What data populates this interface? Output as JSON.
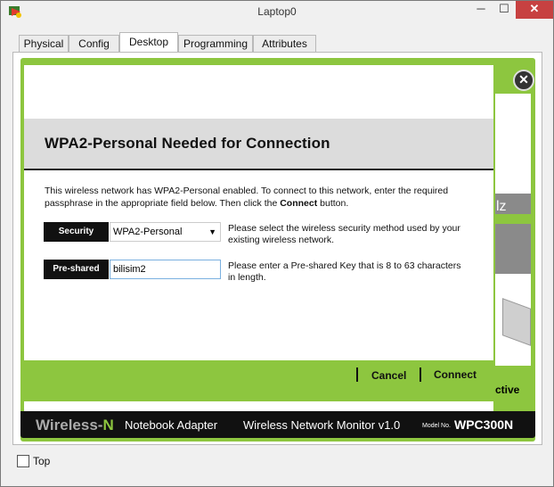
{
  "window": {
    "title": "Laptop0",
    "minimize": "─",
    "maximize": "☐",
    "close": "✕"
  },
  "tabs": [
    {
      "label": "Physical"
    },
    {
      "label": "Config"
    },
    {
      "label": "Desktop"
    },
    {
      "label": "Programming"
    },
    {
      "label": "Attributes"
    }
  ],
  "active_tab": "Desktop",
  "background_app": {
    "partial_text": "lz",
    "status_text": "ctive"
  },
  "dialog": {
    "heading": "WPA2-Personal Needed for Connection",
    "intro_pre": "This wireless network has WPA2-Personal enabled. To connect to this network, enter the required passphrase in the appropriate field below. Then click the ",
    "intro_bold": "Connect",
    "intro_post": " button.",
    "security_label": "Security",
    "security_value": "WPA2-Personal",
    "security_help": "Please select the wireless security method used by your existing wireless network.",
    "psk_label": "Pre-shared Key",
    "psk_value": "bilisim2",
    "psk_help": "Please enter a Pre-shared Key that is 8 to 63 characters in length.",
    "cancel": "Cancel",
    "connect": "Connect"
  },
  "footer": {
    "brand": "Wireless-",
    "brand_n": "N",
    "adapter": "Notebook Adapter",
    "monitor": "Wireless Network Monitor  v1.0",
    "model_label": "Model No.",
    "model": "WPC300N"
  },
  "top_checkbox_label": "Top",
  "colors": {
    "accent_green": "#8dc63f",
    "close_red": "#c74141"
  }
}
